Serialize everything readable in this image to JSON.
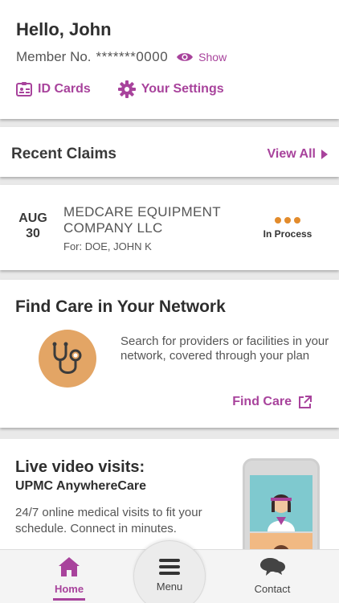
{
  "greeting": {
    "hello": "Hello, John",
    "member_label": "Member No.",
    "member_number": "*******0000",
    "show_label": "Show",
    "id_cards_label": "ID Cards",
    "settings_label": "Your Settings"
  },
  "claims": {
    "title": "Recent Claims",
    "view_all_label": "View All",
    "items": [
      {
        "month": "AUG",
        "day": "30",
        "provider": "MEDCARE EQUIPMENT COMPANY LLC",
        "for": "For: DOE, JOHN K",
        "status": "In Process"
      }
    ]
  },
  "find_care": {
    "title": "Find Care in Your Network",
    "description": "Search for providers or facilities in your network, covered through your plan",
    "link_label": "Find Care"
  },
  "video_visits": {
    "title": "Live video visits:",
    "subtitle": "UPMC AnywhereCare",
    "description": "24/7 online medical visits to fit your schedule. Connect in minutes."
  },
  "tabbar": {
    "home_label": "Home",
    "menu_label": "Menu",
    "contact_label": "Contact"
  },
  "colors": {
    "accent": "#a8439c",
    "status_dot": "#e28b2c",
    "stethoscope_bg": "#e3a565"
  }
}
